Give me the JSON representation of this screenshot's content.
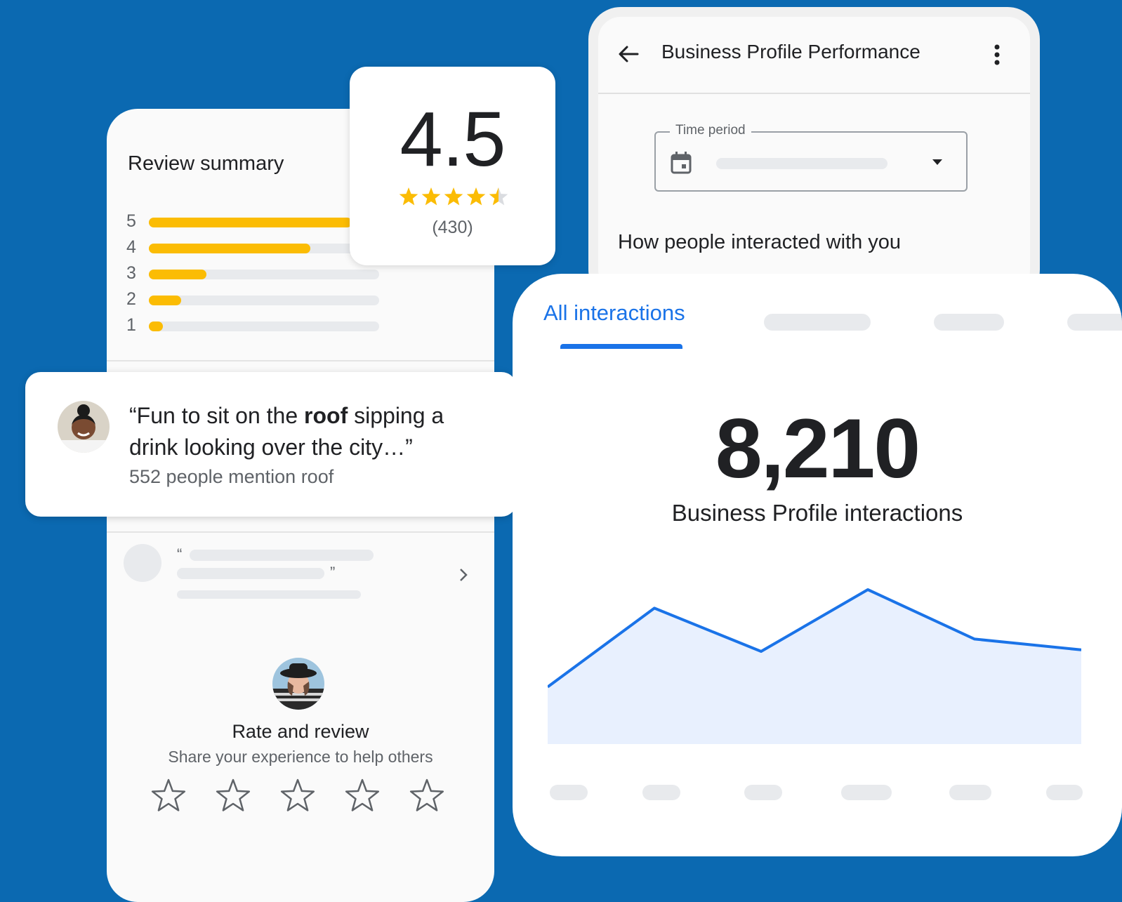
{
  "colors": {
    "background": "#0b69b1",
    "accent_blue": "#1a73e8",
    "star_yellow": "#fbbc04",
    "chart_fill": "#e8f0fe"
  },
  "review_summary": {
    "title": "Review summary",
    "bars": [
      {
        "label": "5",
        "fraction": 0.88
      },
      {
        "label": "4",
        "fraction": 0.7
      },
      {
        "label": "3",
        "fraction": 0.25
      },
      {
        "label": "2",
        "fraction": 0.14
      },
      {
        "label": "1",
        "fraction": 0.06
      }
    ]
  },
  "rating": {
    "value": "4.5",
    "stars": 4.5,
    "count": "(430)"
  },
  "highlight_review": {
    "quote_before": "“Fun to sit on the ",
    "quote_bold": "roof",
    "quote_after": " sipping a drink looking over the city…”",
    "mentions": "552 people mention roof"
  },
  "rate_review": {
    "title": "Rate and review",
    "subtitle": "Share your experience to help others",
    "star_count": 5
  },
  "performance": {
    "title": "Business Profile Performance",
    "time_period_label": "Time period",
    "heading": "How people interacted with you"
  },
  "interactions": {
    "active_tab": "All interactions",
    "count": "8,210",
    "label": "Business Profile interactions",
    "chart_data": {
      "type": "area",
      "title": "",
      "xlabel": "",
      "ylabel": "",
      "ylim": [
        0,
        100
      ],
      "values": [
        37,
        88,
        60,
        100,
        68,
        61
      ]
    }
  }
}
